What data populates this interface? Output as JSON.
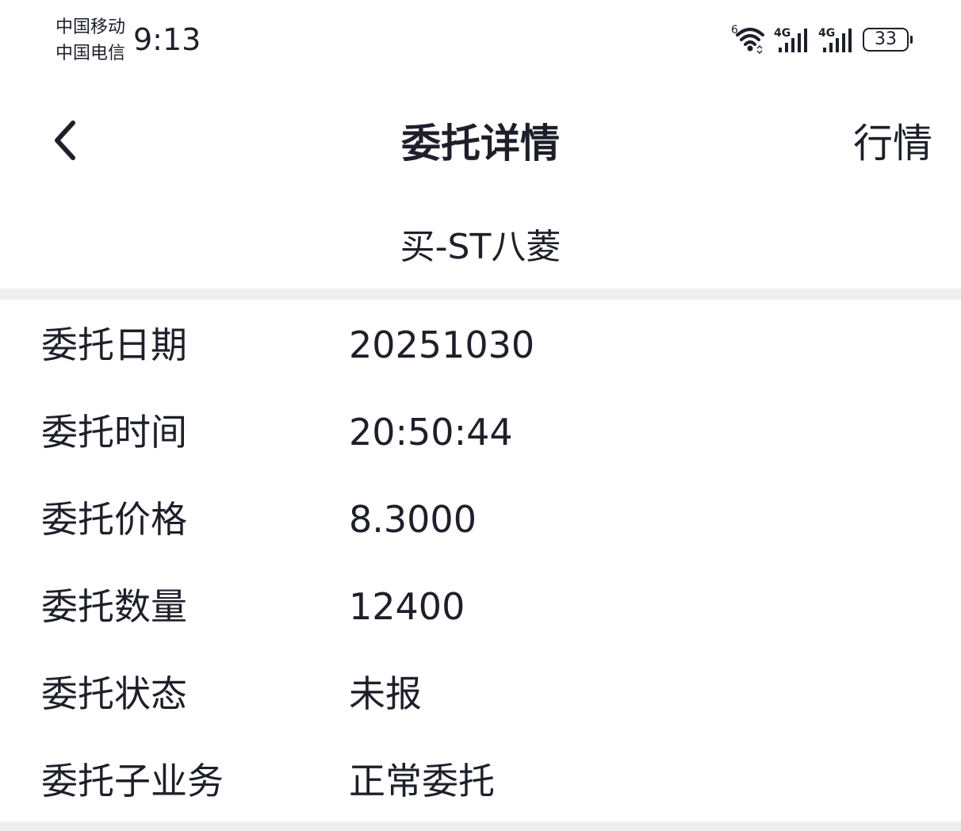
{
  "status_bar": {
    "carrier_1": "中国移动",
    "carrier_2": "中国电信",
    "time": "9:13",
    "wifi_icon": "wifi-6-icon",
    "signal_1_label": "4G",
    "signal_2_label": "4G",
    "battery_level": "33"
  },
  "nav": {
    "back_icon": "chevron-left-icon",
    "title": "委托详情",
    "market_label": "行情"
  },
  "stock": {
    "title": "买-ST八菱"
  },
  "details": [
    {
      "label": "委托日期",
      "value": "20251030"
    },
    {
      "label": "委托时间",
      "value": "20:50:44"
    },
    {
      "label": "委托价格",
      "value": "8.3000"
    },
    {
      "label": "委托数量",
      "value": "12400"
    },
    {
      "label": "委托状态",
      "value": "未报"
    },
    {
      "label": "委托子业务",
      "value": "正常委托"
    }
  ],
  "colors": {
    "text": "#1e1f2b",
    "background": "#ffffff",
    "divider": "#efefef"
  }
}
